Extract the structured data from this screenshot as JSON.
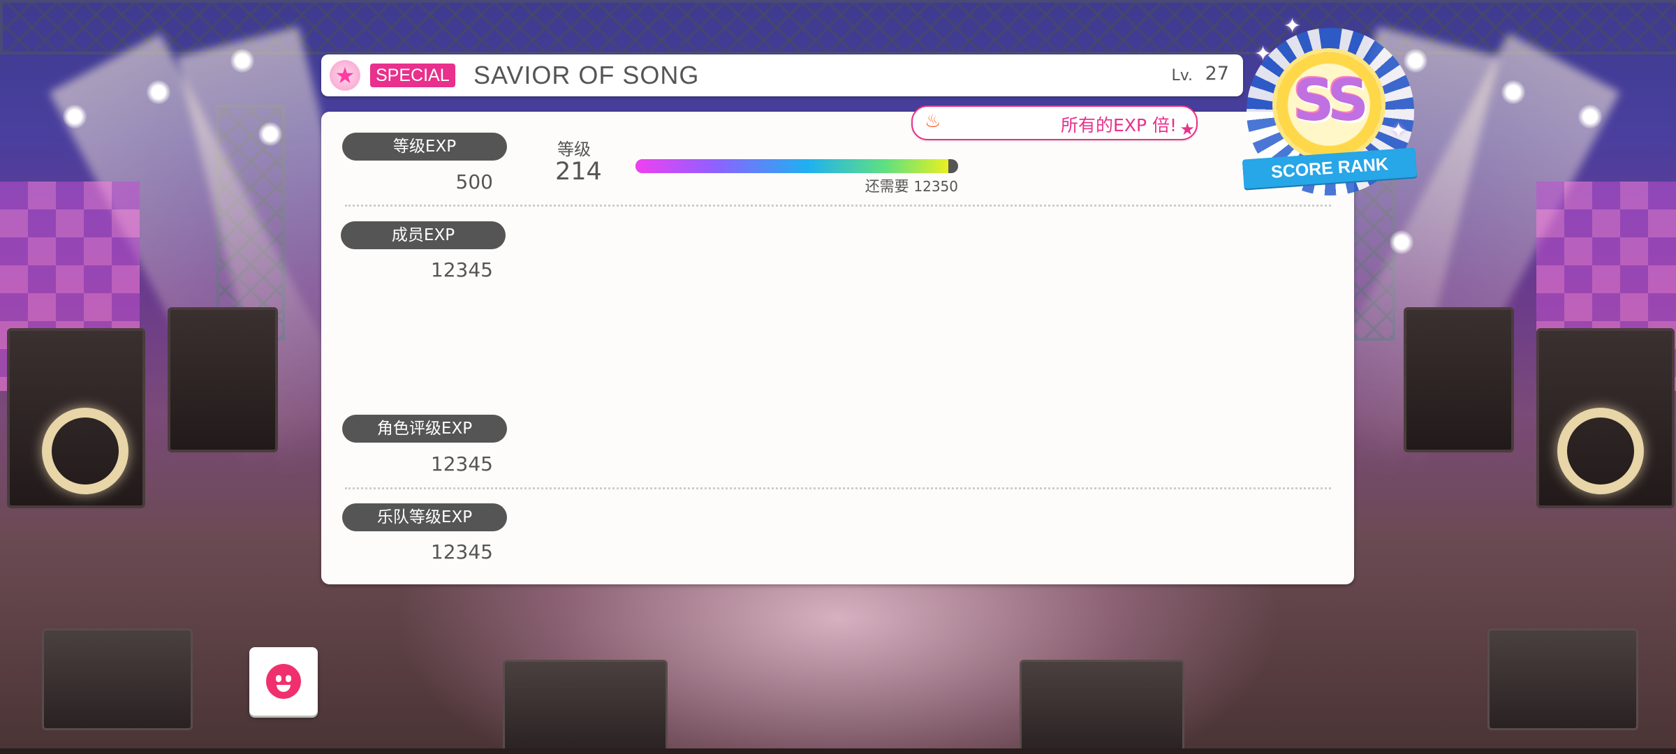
{
  "song": {
    "difficulty": "SPECIAL",
    "title": "SAVIOR OF SONG",
    "level_label": "Lv.",
    "level": "27"
  },
  "rank": {
    "label": "等级",
    "value": "214",
    "progress": 0.97,
    "remaining_text": "还需要",
    "remaining_value": "12350"
  },
  "exp": {
    "rank_exp_label": "等级EXP",
    "rank_exp_value": "500",
    "member_exp_label": "成员EXP",
    "member_exp_value": "12345",
    "character_rank_exp_label": "角色评级EXP",
    "character_rank_exp_value": "12345",
    "band_rank_exp_label": "乐队等级EXP",
    "band_rank_exp_value": "12345"
  },
  "bonus": {
    "text": "所有的EXP  倍!",
    "icon": "flame-icon"
  },
  "score_rank": {
    "grade": "SS",
    "ribbon": "SCORE RANK"
  },
  "colors": {
    "accent_pink": "#e8308c",
    "pill_gray": "#555555",
    "ribbon_blue": "#27a6e8"
  }
}
